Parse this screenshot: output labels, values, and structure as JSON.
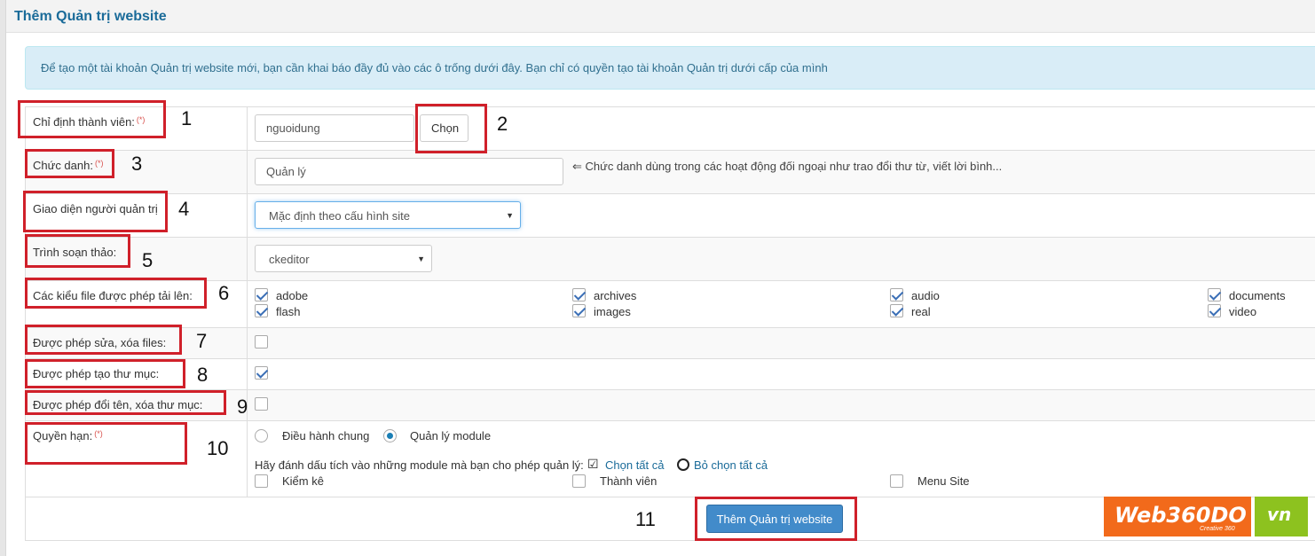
{
  "page": {
    "title": "Thêm Quản trị website"
  },
  "info": {
    "text": "Để tạo một tài khoản Quản trị website mới, bạn cần khai báo đầy đủ vào các ô trống dưới đây. Bạn chỉ có quyền tạo tài khoản Quản trị dưới cấp của mình"
  },
  "required_mark": "(*)",
  "fields": {
    "member": {
      "label": "Chỉ định thành viên:",
      "value": "nguoidung",
      "button": "Chọn"
    },
    "position": {
      "label": "Chức danh:",
      "value": "Quản lý",
      "hint": "⇐ Chức danh dùng trong các hoạt động đối ngoại như trao đổi thư từ, viết lời bình..."
    },
    "theme": {
      "label": "Giao diện người quản trị",
      "value": "Mặc định theo cấu hình site"
    },
    "editor": {
      "label": "Trình soạn thảo:",
      "value": "ckeditor"
    },
    "file_types": {
      "label": "Các kiểu file được phép tải lên:",
      "items": [
        {
          "name": "adobe",
          "checked": true
        },
        {
          "name": "archives",
          "checked": true
        },
        {
          "name": "audio",
          "checked": true
        },
        {
          "name": "documents",
          "checked": true
        },
        {
          "name": "flash",
          "checked": true
        },
        {
          "name": "images",
          "checked": true
        },
        {
          "name": "real",
          "checked": true
        },
        {
          "name": "video",
          "checked": true
        }
      ]
    },
    "edit_files": {
      "label": "Được phép sửa, xóa files:",
      "checked": false
    },
    "create_dir": {
      "label": "Được phép tạo thư mục:",
      "checked": true
    },
    "rename_dir": {
      "label": "Được phép đổi tên, xóa thư mục:",
      "checked": false
    },
    "permission": {
      "label": "Quyền hạn:",
      "options": [
        {
          "label": "Điều hành chung",
          "selected": false
        },
        {
          "label": "Quản lý module",
          "selected": true
        }
      ],
      "module_prompt": "Hãy đánh dấu tích vào những module mà bạn cho phép quản lý:",
      "select_all": "Chọn tất cả",
      "deselect_all": "Bỏ chọn tất cả",
      "modules": [
        {
          "name": "Kiểm kê",
          "checked": false
        },
        {
          "name": "Thành viên",
          "checked": false
        },
        {
          "name": "Menu Site",
          "checked": false
        }
      ]
    }
  },
  "submit": {
    "label": "Thêm Quản trị website"
  },
  "annotations": [
    "1",
    "2",
    "3",
    "4",
    "5",
    "6",
    "7",
    "8",
    "9",
    "10",
    "11"
  ],
  "logo": {
    "main": "Web360DO",
    "sub": "Creative 360",
    "tld": "vn"
  },
  "colors": {
    "title": "#1a6b99",
    "info_bg": "#d9edf7",
    "annotation": "#d0202a",
    "primary": "#428bca",
    "logo_orange": "#f26a1b",
    "logo_green": "#8dc21f"
  }
}
